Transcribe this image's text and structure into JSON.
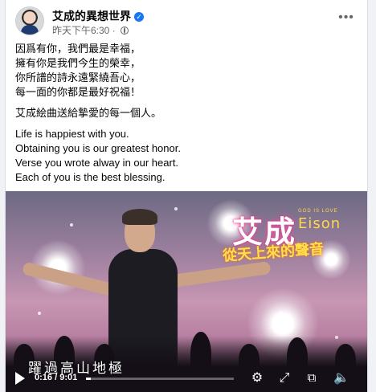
{
  "post": {
    "author": "艾成的異想世界",
    "timestamp": "昨天下午6:30",
    "paragraphs": [
      [
        "因爲有你，我們最是幸福，",
        "擁有你是我們今生的榮幸，",
        "你所譜的詩永遠緊繞吾心，",
        "每一面的你都是最好祝福！"
      ],
      [
        "艾成絵曲送給摯愛的每一個人。"
      ],
      [
        "Life is happiest with you.",
        "Obtaining you is our greatest honor.",
        "Verse you wrote alway in our heart.",
        "Each of you is the best blessing."
      ]
    ]
  },
  "video": {
    "title_cn": "艾成",
    "tagline": "GOD IS LOVE",
    "title_en": "Eison",
    "subtitle_cn": "從天上來的聲音",
    "song_caption": "躍過高山地極",
    "current_time": "0:16",
    "duration": "9:01",
    "progress": 0.03
  },
  "icons": {
    "verified": "verified-badge-icon",
    "privacy": "globe-icon",
    "more": "more-options-icon",
    "play": "play-icon",
    "settings": "gear-icon",
    "expand": "expand-icon",
    "pip": "picture-in-picture-icon",
    "volume": "volume-icon"
  },
  "colors": {
    "accent": "#1877f2",
    "meta_text": "#65676b"
  }
}
